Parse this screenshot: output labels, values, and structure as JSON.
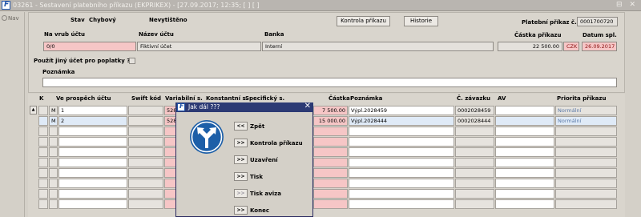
{
  "window": {
    "title": "03261 - Sestavení platebního příkazu (EKPRIKEX) - [27.09.2017; 12:35; [ ] [ ]",
    "controls": "⊟ ✕"
  },
  "sidebar": {
    "nav_label": "Nav"
  },
  "header": {
    "stav_label": "Stav",
    "stav_value": "Chybový",
    "tisk_value": "Nevytištěno",
    "kontrola_button": "Kontrola příkazu",
    "historie_button": "Historie",
    "prikaz_label": "Platební příkaz č.",
    "prikaz_value": "0001700720"
  },
  "fields": {
    "na_vrub_label": "Na vrub účtu",
    "na_vrub_value": "0/0",
    "nazev_label": "Název účtu",
    "nazev_value": "Fiktivní účet",
    "banka_label": "Banka",
    "banka_value": "Interní",
    "castka_label": "Částka příkazu",
    "castka_value": "22 500.00",
    "mena_value": "CZK",
    "datum_label": "Datum spl.",
    "datum_value": "26.09.2017",
    "jiny_ucet_label": "Použít jiný účet pro poplatky ?",
    "poznamka_label": "Poznámka",
    "poznamka_value": ""
  },
  "table": {
    "columns": [
      "K",
      "Ve prospěch účtu",
      "Swift kód",
      "Variabilní s.",
      "Konstantní s.",
      "Specifický s.",
      "Částka",
      "Poznámka",
      "Č. závazku",
      "AV",
      "Priorita příkazu"
    ],
    "scroll_up": "▲",
    "rows": [
      {
        "m": "M",
        "ucet": "1",
        "vs": "528",
        "castka": "7 500.00",
        "poznamka": "Výpl.2028459",
        "zavazek": "0002028459",
        "priorita": "Normální"
      },
      {
        "m": "M",
        "ucet": "2",
        "vs": "528",
        "castka": "15 000.00",
        "poznamka": "Výpl.2028444",
        "zavazek": "0002028444",
        "priorita": "Normální"
      }
    ]
  },
  "dialog": {
    "title": "Jak dál ???",
    "close": "✕",
    "items": [
      {
        "btn": "<<",
        "label": "Zpět"
      },
      {
        "btn": ">>",
        "label": "Kontrola příkazu"
      },
      {
        "btn": ">>",
        "label": "Uzavření"
      },
      {
        "btn": ">>",
        "label": "Tisk"
      },
      {
        "btn": ">>",
        "label": "Tisk aviza"
      },
      {
        "btn": ">>",
        "label": "Konec"
      }
    ]
  },
  "colors": {
    "accent": "#2c3a74",
    "required": "#f6c6c6",
    "selected_row": "#dfeaf7",
    "sign_blue": "#1d5fa8"
  }
}
